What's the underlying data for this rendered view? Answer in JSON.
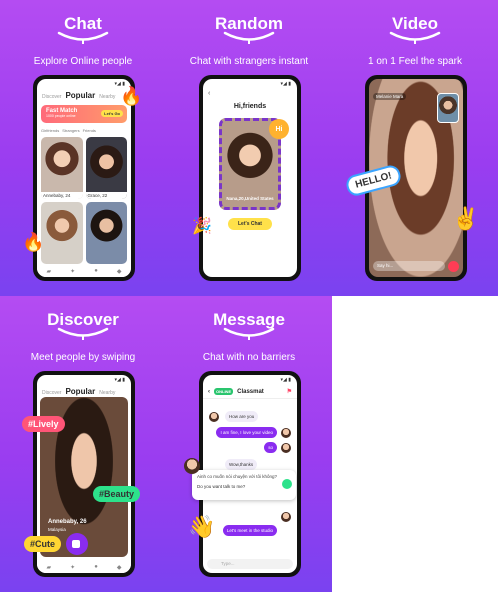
{
  "colors": {
    "panel_bg": "#9a3df0",
    "accent": "#8a2cf0",
    "button_yellow": "#ffe14a"
  },
  "panels": {
    "chat": {
      "headline": "Chat",
      "subtitle": "Explore Online people",
      "tabs": [
        "Discover",
        "Popular",
        "Nearby"
      ],
      "fast_match": {
        "title": "Fast Match",
        "sub": "1000 people online",
        "cta": "Let's Go"
      },
      "chips": [
        "Girlfriends",
        "Strangers",
        "Friends"
      ],
      "cards": [
        {
          "caption": "Annebaby, 24"
        },
        {
          "caption": "Grace, 22"
        },
        {
          "caption": ""
        },
        {
          "caption": ""
        }
      ],
      "icons": [
        "fire-icon",
        "fire-icon"
      ]
    },
    "random": {
      "headline": "Random",
      "subtitle": "Chat with strangers instant",
      "greeting": "Hi,friends",
      "hi": "Hi",
      "card_caption": "Nana,20,United States",
      "button": "Let's Chat"
    },
    "video": {
      "headline": "Video",
      "subtitle": "1 on 1 Feel the spark",
      "caller": "Melanie Mara",
      "sticker": "HELLO!",
      "input_placeholder": "Say hi..."
    },
    "discover": {
      "headline": "Discover",
      "subtitle": "Meet people by swiping",
      "tabs": [
        "Discover",
        "Popular",
        "Nearby"
      ],
      "name": "Annebaby, 26",
      "location": "Malaysia",
      "tags": [
        "#Lively",
        "#Beauty",
        "#Cute"
      ]
    },
    "message": {
      "headline": "Message",
      "subtitle": "Chat with no barriers",
      "status": "ONLINE",
      "contact": "Classmat",
      "messages": [
        {
          "dir": "in",
          "text": "How are you"
        },
        {
          "dir": "out",
          "text": "I am fine, I love your video"
        },
        {
          "dir": "out",
          "text": "so"
        },
        {
          "dir": "in",
          "text": "Wow,thanks"
        }
      ],
      "translate": {
        "original": "Ainh co muốn nói chuyện với tôi không?",
        "translated": "Do you want talk to me?"
      },
      "final": "Let's meet in the studio",
      "input_placeholder": "Type..."
    }
  }
}
